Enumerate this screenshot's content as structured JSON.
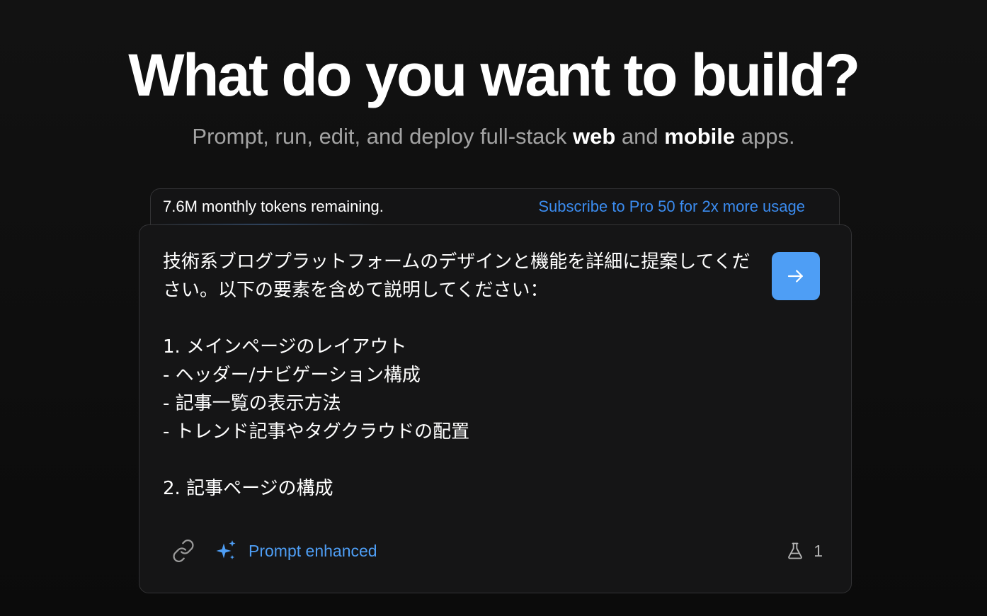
{
  "hero": {
    "title": "What do you want to build?",
    "subtitle_prefix": "Prompt, run, edit, and deploy full-stack ",
    "subtitle_web": "web",
    "subtitle_and": " and ",
    "subtitle_mobile": "mobile",
    "subtitle_suffix": " apps."
  },
  "token_banner": {
    "remaining_text": "7.6M monthly tokens remaining.",
    "subscribe_link": "Subscribe to Pro 50 for 2x more usage"
  },
  "prompt": {
    "text": "技術系ブログプラットフォームのデザインと機能を詳細に提案してください。以下の要素を含めて説明してください：\n\n1. メインページのレイアウト\n- ヘッダー/ナビゲーション構成\n- 記事一覧の表示方法\n- トレンド記事やタグクラウドの配置\n\n2. 記事ページの構成"
  },
  "toolbar": {
    "enhance_label": "Prompt enhanced",
    "experiments_count": "1"
  },
  "icons": {
    "send": "arrow-right-icon",
    "attach": "link-icon",
    "enhance": "sparkles-icon",
    "experiments": "flask-icon"
  },
  "colors": {
    "accent": "#4e9ef5",
    "link": "#3b8cf0",
    "background": "#0c0c0c",
    "card": "#151516",
    "border": "#333335"
  }
}
